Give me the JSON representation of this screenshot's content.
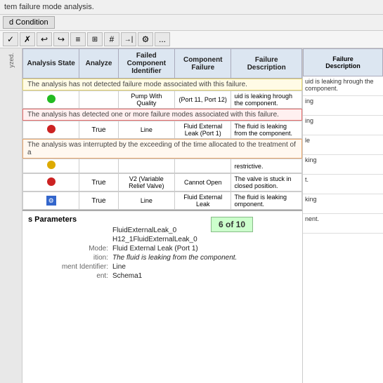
{
  "topBar": {
    "text": "tem failure mode analysis."
  },
  "tabs": {
    "conditionTab": "d Condition"
  },
  "toolbar": {
    "buttons": [
      "✓",
      "✗",
      "↩",
      "↪",
      "≡",
      "⊞",
      "#",
      "→|",
      "⚙",
      "..."
    ]
  },
  "table": {
    "headers": [
      "Analysis State",
      "Analyze",
      "Failed Component Identifier",
      "Component Failure",
      "Failure Description"
    ],
    "infoBar1": "The analysis has not detected failure mode associated with this failure.",
    "infoBar2": "The analysis has detected one or more failure modes associated with this failure.",
    "infoBar3": "The analysis was interrupted by the exceeding of the time allocated to the treatment of a",
    "rows": [
      {
        "dot": "green",
        "analyze": "",
        "compId": "Pump With Quality",
        "compFailure": "(Port 11, Port 12)",
        "desc": "uid is leaking hrough the component."
      },
      {
        "dot": "red",
        "analyze": "True",
        "compId": "Line",
        "compFailure": "Fluid External Leak (Port 1)",
        "desc": "The fluid is leaking from the component."
      },
      {
        "dot": "yellow",
        "analyze": "",
        "compId": "",
        "compFailure": "",
        "desc": "restrictive."
      },
      {
        "dot": "red",
        "analyze": "True",
        "compId": "V2 (Variable Relief Valve)",
        "compFailure": "Cannot Open",
        "desc": "The valve is stuck in closed position."
      },
      {
        "dot": "blue-gear",
        "analyze": "True",
        "compId": "Line",
        "compFailure": "Fluid External Leak",
        "desc": "The fluid is leaking omponent."
      }
    ]
  },
  "rightColumn": {
    "cells": [
      "uid is leaking hrough the component.",
      "ing",
      "ing\nle\nking\nt.\nking\nnent."
    ]
  },
  "bottomPanel": {
    "title": "s Parameters",
    "fields": [
      {
        "label": "",
        "value": "FluidExternalLeak_0"
      },
      {
        "label": "",
        "value": "H12_1FluidExternalLeak_0"
      },
      {
        "label": "Mode:",
        "value": "Fluid External Leak (Port 1)"
      },
      {
        "label": "ition:",
        "value": "The fluid is leaking from the component."
      },
      {
        "label": "ment Identifier:",
        "value": "Line"
      },
      {
        "label": "ent:",
        "value": "Schema1"
      }
    ],
    "counter": "6 of 10"
  },
  "leftSidebar": {
    "label": "yzed."
  }
}
